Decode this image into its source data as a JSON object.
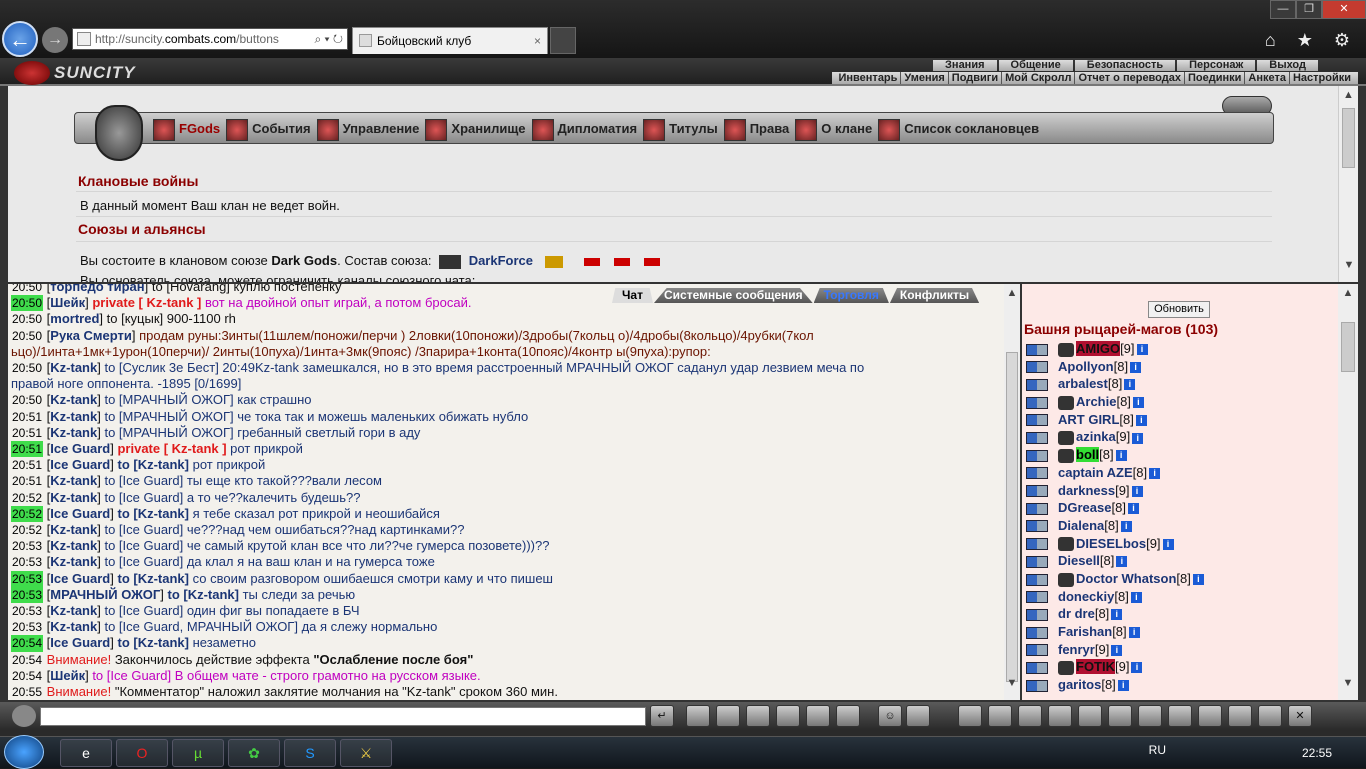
{
  "browser": {
    "url_prefix": "http://suncity.",
    "url_domain": "combats.com",
    "url_suffix": "/buttons",
    "url_tools": "⌕ ▾ ↻",
    "tab_title": "Бойцовский клуб",
    "tab_close": "×",
    "back": "←",
    "forward": "→",
    "icons": "⌂ ★ ⚙",
    "win_min": "—",
    "win_max": "❐",
    "win_close": "✕"
  },
  "header": {
    "logo": "SUNCITY",
    "menu_top": [
      "Знания",
      "Общение",
      "Безопасность",
      "Персонаж",
      "Выход"
    ],
    "menu_bottom": [
      "Инвентарь",
      "Умения",
      "Подвиги",
      "Мой Скролл",
      "Отчет о переводах",
      "Поединки",
      "Анкета",
      "Настройки"
    ]
  },
  "clan_nav": [
    {
      "label": "FGods"
    },
    {
      "label": "События"
    },
    {
      "label": "Управление"
    },
    {
      "label": "Хранилище"
    },
    {
      "label": "Дипломатия"
    },
    {
      "label": "Титулы"
    },
    {
      "label": "Права"
    },
    {
      "label": "О клане"
    },
    {
      "label": "Список соклановцев"
    }
  ],
  "wars": {
    "title": "Клановые войны",
    "text": "В данный момент Ваш клан не ведет войн."
  },
  "alliances": {
    "title": "Союзы и альянсы",
    "text_pre": "Вы состоите в клановом союзе ",
    "union": "Dark Gods",
    "text_mid": ". Состав союза: ",
    "member": "DarkForce",
    "text_cut": "Вы основатель союза, можете ограничить каналы союзного чата:"
  },
  "chat_tabs": [
    "Чат",
    "Системные сообщения",
    "Торговля",
    "Конфликты"
  ],
  "chat": [
    {
      "t": "20:50",
      "g": false,
      "nm": "торпедо тиран",
      "tx": " to [Hovarang] куплю постепенку",
      "cls": ""
    },
    {
      "t": "20:50",
      "g": true,
      "nm": "Шейк",
      "pv": " private [ Kz-tank ] ",
      "tx": "вот на двойной опыт играй, а потом бросай.",
      "cls": "mg"
    },
    {
      "t": "20:50",
      "g": false,
      "nm": "mortred",
      "tx": " to [куцык] 900-1100 rh",
      "cls": ""
    },
    {
      "t": "20:50",
      "g": false,
      "nm": "Рука Смерти",
      "tx": " продам руны:3инты(11шлем/поножи/перчи ) 2ловки(10поножи)/3дробы(7кольц о)/4дробы(8кольцо)/4рубки(7кол",
      "cls": "mr"
    },
    {
      "t": "",
      "g": false,
      "nm": "",
      "tx": "ьцо)/1инта+1мк+1урон(10перчи)/ 2инты(10пуха)/1инта+3мк(9пояс) /3парира+1конта(10пояс)/4контр ы(9пуха):рупор:",
      "cls": "mr"
    },
    {
      "t": "20:50",
      "g": false,
      "nm": "Kz-tank",
      "tx": " to [Суслик 3е Бест] 20:49Kz-tank замешкался, но в это время расстроенный МРАЧНЫЙ ОЖОГ саданул удар лезвием меча по",
      "cls": "bl"
    },
    {
      "t": "",
      "g": false,
      "nm": "",
      "tx": "правой ноге оппонента. -1895 [0/1699]",
      "cls": "bl"
    },
    {
      "t": "20:50",
      "g": false,
      "nm": "Kz-tank",
      "tx": " to [МРАЧНЫЙ ОЖОГ] как страшно",
      "cls": "bl"
    },
    {
      "t": "20:51",
      "g": false,
      "nm": "Kz-tank",
      "tx": " to [МРАЧНЫЙ ОЖОГ] че тока так и можешь маленьких обижать нубло",
      "cls": "bl"
    },
    {
      "t": "20:51",
      "g": false,
      "nm": "Kz-tank",
      "tx": " to [МРАЧНЫЙ ОЖОГ] гребанный светлый гори в аду",
      "cls": "bl"
    },
    {
      "t": "20:51",
      "g": true,
      "nm": "Ice Guard",
      "pv": " private [ Kz-tank ] ",
      "tx": "рот прикрой",
      "cls": "bl"
    },
    {
      "t": "20:51",
      "g": false,
      "nm": "Ice Guard",
      "bt": " to [Kz-tank] ",
      "tx": "рот прикрой",
      "cls": "bl"
    },
    {
      "t": "20:51",
      "g": false,
      "nm": "Kz-tank",
      "tx": " to [Ice Guard] ты еще кто такой???вали лесом",
      "cls": "bl"
    },
    {
      "t": "20:52",
      "g": false,
      "nm": "Kz-tank",
      "tx": " to [Ice Guard] а то че??калечить будешь??",
      "cls": "bl"
    },
    {
      "t": "20:52",
      "g": true,
      "nm": "Ice Guard",
      "bt": " to [Kz-tank] ",
      "tx": "я тебе сказал рот прикрой и неошибайся",
      "cls": "bl"
    },
    {
      "t": "20:52",
      "g": false,
      "nm": "Kz-tank",
      "tx": " to [Ice Guard] че???над чем ошибаться??над картинками??",
      "cls": "bl"
    },
    {
      "t": "20:53",
      "g": false,
      "nm": "Kz-tank",
      "tx": " to [Ice Guard] че самый крутой клан все что ли??че гумерса позовете)))??",
      "cls": "bl"
    },
    {
      "t": "20:53",
      "g": false,
      "nm": "Kz-tank",
      "tx": " to [Ice Guard] да клал я на ваш клан и на гумерса тоже",
      "cls": "bl"
    },
    {
      "t": "20:53",
      "g": true,
      "nm": "Ice Guard",
      "bt": " to [Kz-tank] ",
      "tx": "со своим разговором ошибаешся смотри каму и что пишеш",
      "cls": "bl"
    },
    {
      "t": "20:53",
      "g": true,
      "nm": "МРАЧНЫЙ ОЖОГ",
      "bt": " to [Kz-tank] ",
      "tx": "ты следи за речью",
      "cls": "bl"
    },
    {
      "t": "20:53",
      "g": false,
      "nm": "Kz-tank",
      "tx": " to [Ice Guard] один фиг вы попадаете в БЧ",
      "cls": "bl"
    },
    {
      "t": "20:53",
      "g": false,
      "nm": "Kz-tank",
      "tx": " to [Ice Guard, МРАЧНЫЙ ОЖОГ] да я слежу нормально",
      "cls": "bl"
    },
    {
      "t": "20:54",
      "g": true,
      "nm": "Ice Guard",
      "bt": " to [Kz-tank] ",
      "tx": "незаметно",
      "cls": "bl"
    },
    {
      "t": "20:54",
      "g": false,
      "nm": "",
      "warn": "Внимание!",
      "tx": " Закончилось действие эффекта ",
      "bold": "\"Ослабление после боя\"",
      "cls": ""
    },
    {
      "t": "20:54",
      "g": false,
      "nm": "Шейк",
      "tx": " to [Ice Guard] В общем чате - строго грамотно на русском языке.",
      "cls": "mg"
    },
    {
      "t": "20:55",
      "g": false,
      "nm": "",
      "warn": "Внимание!",
      "tx": " \"Комментатор\" наложил заклятие молчания на \"Kz-tank\" сроком 360 мин.",
      "cls": ""
    }
  ],
  "users_panel": {
    "refresh": "Обновить",
    "room": "Башня рыцарей-магов (103)",
    "info_label": "i",
    "users": [
      {
        "name": "AMIGO",
        "lvl": "[9]",
        "hl": "red"
      },
      {
        "name": "Apollyon",
        "lvl": "[8]",
        "hl": ""
      },
      {
        "name": "arbalest",
        "lvl": "[8]",
        "hl": ""
      },
      {
        "name": "Archie",
        "lvl": "[8]",
        "hl": ""
      },
      {
        "name": "ART GIRL",
        "lvl": "[8]",
        "hl": ""
      },
      {
        "name": "azinka",
        "lvl": "[9]",
        "hl": ""
      },
      {
        "name": "boll",
        "lvl": "[8]",
        "hl": "green"
      },
      {
        "name": "captain AZE",
        "lvl": "[8]",
        "hl": ""
      },
      {
        "name": "darkness",
        "lvl": "[9]",
        "hl": ""
      },
      {
        "name": "DGrease",
        "lvl": "[8]",
        "hl": ""
      },
      {
        "name": "Dialena",
        "lvl": "[8]",
        "hl": ""
      },
      {
        "name": "DIESELbos",
        "lvl": "[9]",
        "hl": ""
      },
      {
        "name": "Diesell",
        "lvl": "[8]",
        "hl": ""
      },
      {
        "name": "Doctor Whatson",
        "lvl": "[8]",
        "hl": ""
      },
      {
        "name": "doneckiy",
        "lvl": "[8]",
        "hl": ""
      },
      {
        "name": "dr dre",
        "lvl": "[8]",
        "hl": ""
      },
      {
        "name": "Farishan",
        "lvl": "[8]",
        "hl": ""
      },
      {
        "name": "fenryr",
        "lvl": "[9]",
        "hl": ""
      },
      {
        "name": "FOTIK",
        "lvl": "[9]",
        "hl": "red"
      },
      {
        "name": "garitos",
        "lvl": "[8]",
        "hl": ""
      }
    ]
  },
  "taskbar": {
    "lang": "RU",
    "time": "22:55"
  }
}
